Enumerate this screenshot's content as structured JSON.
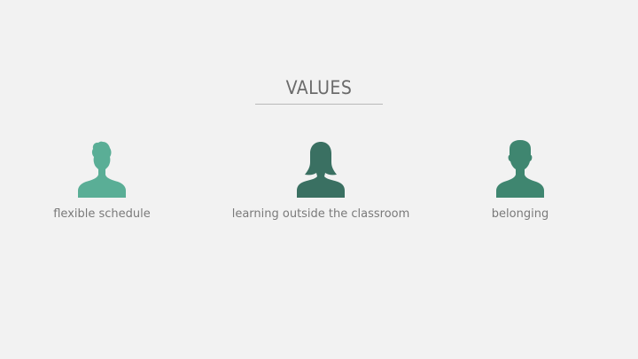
{
  "slide": {
    "title": "VALUES",
    "values": [
      {
        "label": "flexible schedule",
        "icon": "person-curly-hair-icon",
        "color": "#5aae96"
      },
      {
        "label": "learning outside the classroom",
        "icon": "person-long-hair-icon",
        "color": "#3a7062"
      },
      {
        "label": "belonging",
        "icon": "person-short-hair-icon",
        "color": "#3f8670"
      }
    ]
  },
  "colors": {
    "background": "#f2f2f2",
    "title": "#6b6b6b",
    "label": "#7a7a7a",
    "rule": "#b9b9b9"
  }
}
